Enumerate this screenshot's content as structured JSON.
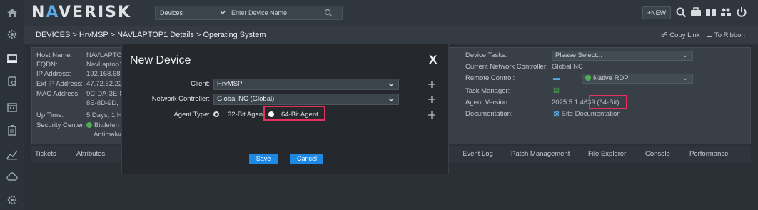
{
  "brand": {
    "logo_pre": "N",
    "logo_a": "A",
    "logo_post": "VERISK"
  },
  "topbar": {
    "device_select": "Devices",
    "device_placeholder": "Enter Device Name",
    "new_label": "+NEW"
  },
  "breadcrumb": {
    "text": "DEVICES > HrvMSP > NAVLAPTOP1 Details > Operating System"
  },
  "header_links": {
    "copy_link": "Copy Link",
    "to_ribbon": "To Ribbon"
  },
  "details_left": {
    "host_name_label": "Host Name:",
    "host_name": "NAVLAPTOP1",
    "fqdn_label": "FQDN:",
    "fqdn": "NavLaptop1",
    "ip_label": "IP Address:",
    "ip": "192.168.68.",
    "ext_ip_label": "Ext IP Address:",
    "ext_ip": "47.72.62.22",
    "mac_label": "MAC Address:",
    "mac1": "9C-DA-3E-8",
    "mac2": "8E-8D-9D, 9",
    "uptime_label": "Up Time:",
    "uptime": "5 Days, 1 H",
    "security_label": "Security Center:",
    "security1": "Bitdefen",
    "security2": "Antimalwar"
  },
  "details_right": {
    "tasks_label": "Device Tasks:",
    "tasks_value": "Please Select...",
    "network_label": "Current Network Controller:",
    "network_value": "Global NC",
    "remote_label": "Remote Control:",
    "remote_value": "Native RDP",
    "taskmgr_label": "Task Manager:",
    "agent_label": "Agent Version:",
    "agent_value": "2025.5.1.4639 (64-Bit)",
    "doc_label": "Documentation:",
    "doc_value": "Site Documentation"
  },
  "tabs": [
    "Tickets",
    "Attributes",
    "Event Log",
    "Patch Management",
    "File Explorer",
    "Console",
    "Performance"
  ],
  "modal": {
    "title": "New Device",
    "close": "X",
    "client_label": "Client:",
    "client_value": "HrvMSP",
    "network_label": "Network Controller:",
    "network_value": "Global NC (Global)",
    "agent_type_label": "Agent Type:",
    "option_32": "32-Bit Agent",
    "option_64": "64-Bit Agent",
    "save_label": "Save",
    "cancel_label": "Cancel"
  },
  "colors": {
    "accent": "#1e88e5",
    "highlight": "#e8305e",
    "logo_accent": "#5aa9e6",
    "status_green": "#4caf50"
  },
  "icons": [
    "home-icon",
    "settings-icon",
    "monitor-icon",
    "scripts-icon",
    "calendar-icon",
    "clipboard-icon",
    "chart-icon",
    "cloud-icon",
    "gear-icon",
    "search-icon",
    "briefcase-icon",
    "book-icon",
    "users-icon",
    "power-icon"
  ]
}
